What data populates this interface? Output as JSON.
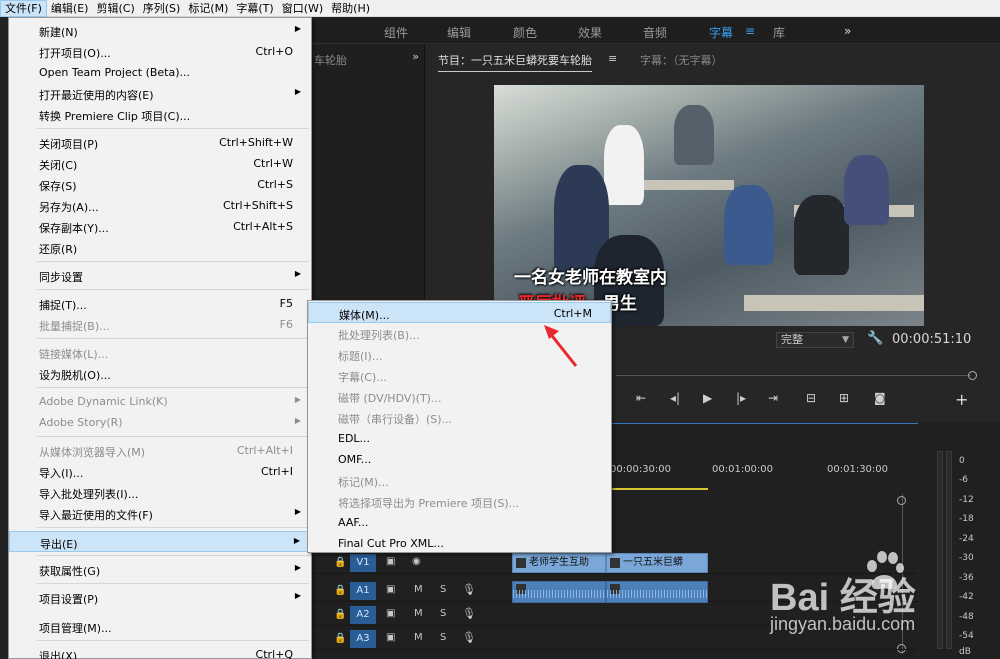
{
  "menubar": {
    "items": [
      "文件(F)",
      "编辑(E)",
      "剪辑(C)",
      "序列(S)",
      "标记(M)",
      "字幕(T)",
      "窗口(W)",
      "帮助(H)"
    ]
  },
  "workspace": {
    "tabs": [
      "组件",
      "编辑",
      "颜色",
      "效果",
      "音频",
      "字幕",
      "库"
    ],
    "active": "字幕"
  },
  "project_panel": {
    "title": "车轮胎"
  },
  "program_monitor": {
    "tab_program": "节目：一只五米巨蟒死要车轮胎",
    "tab_captions": "字幕：（无字幕）",
    "subtitle_line1": "一名女老师在教室内",
    "subtitle_line2_red": "严厉批评",
    "subtitle_line2_white": "一男生",
    "quality": "完整",
    "timecode": "00:00:51:10"
  },
  "timeline": {
    "ruler": [
      "00:00:30:00",
      "00:01:00:00",
      "00:01:30:00"
    ],
    "tracks": [
      "V1",
      "A1",
      "A2",
      "A3"
    ],
    "track_buttons": [
      "M",
      "S"
    ],
    "clips": [
      "老师学生互助",
      "一只五米巨蟒"
    ]
  },
  "audio_meter": {
    "db": [
      "0",
      "-6",
      "-12",
      "-18",
      "-24",
      "-30",
      "-36",
      "-42",
      "-48",
      "-54",
      "dB"
    ]
  },
  "file_menu": {
    "items": [
      {
        "label": "新建(N)",
        "shortcut": "",
        "arrow": true,
        "disabled": false
      },
      {
        "label": "打开项目(O)...",
        "shortcut": "Ctrl+O",
        "arrow": false,
        "disabled": false
      },
      {
        "label": "Open Team Project (Beta)...",
        "shortcut": "",
        "arrow": false,
        "disabled": false
      },
      {
        "label": "打开最近使用的内容(E)",
        "shortcut": "",
        "arrow": true,
        "disabled": false
      },
      {
        "label": "转换 Premiere Clip 项目(C)...",
        "shortcut": "",
        "arrow": false,
        "disabled": false
      },
      {
        "label": "关闭项目(P)",
        "shortcut": "Ctrl+Shift+W",
        "arrow": false,
        "disabled": false
      },
      {
        "label": "关闭(C)",
        "shortcut": "Ctrl+W",
        "arrow": false,
        "disabled": false
      },
      {
        "label": "保存(S)",
        "shortcut": "Ctrl+S",
        "arrow": false,
        "disabled": false
      },
      {
        "label": "另存为(A)...",
        "shortcut": "Ctrl+Shift+S",
        "arrow": false,
        "disabled": false
      },
      {
        "label": "保存副本(Y)...",
        "shortcut": "Ctrl+Alt+S",
        "arrow": false,
        "disabled": false
      },
      {
        "label": "还原(R)",
        "shortcut": "",
        "arrow": false,
        "disabled": false
      },
      {
        "label": "同步设置",
        "shortcut": "",
        "arrow": true,
        "disabled": false
      },
      {
        "label": "捕捉(T)...",
        "shortcut": "F5",
        "arrow": false,
        "disabled": false
      },
      {
        "label": "批量捕捉(B)...",
        "shortcut": "F6",
        "arrow": false,
        "disabled": true
      },
      {
        "label": "链接媒体(L)...",
        "shortcut": "",
        "arrow": false,
        "disabled": true
      },
      {
        "label": "设为脱机(O)...",
        "shortcut": "",
        "arrow": false,
        "disabled": false
      },
      {
        "label": "Adobe Dynamic Link(K)",
        "shortcut": "",
        "arrow": true,
        "disabled": true
      },
      {
        "label": "Adobe Story(R)",
        "shortcut": "",
        "arrow": true,
        "disabled": true
      },
      {
        "label": "从媒体浏览器导入(M)",
        "shortcut": "Ctrl+Alt+I",
        "arrow": false,
        "disabled": true
      },
      {
        "label": "导入(I)...",
        "shortcut": "Ctrl+I",
        "arrow": false,
        "disabled": false
      },
      {
        "label": "导入批处理列表(I)...",
        "shortcut": "",
        "arrow": false,
        "disabled": false
      },
      {
        "label": "导入最近使用的文件(F)",
        "shortcut": "",
        "arrow": true,
        "disabled": false
      },
      {
        "label": "导出(E)",
        "shortcut": "",
        "arrow": true,
        "disabled": false
      },
      {
        "label": "获取属性(G)",
        "shortcut": "",
        "arrow": true,
        "disabled": false
      },
      {
        "label": "项目设置(P)",
        "shortcut": "",
        "arrow": true,
        "disabled": false
      },
      {
        "label": "项目管理(M)...",
        "shortcut": "",
        "arrow": false,
        "disabled": false
      },
      {
        "label": "退出(X)",
        "shortcut": "Ctrl+Q",
        "arrow": false,
        "disabled": false
      }
    ]
  },
  "export_menu": {
    "items": [
      {
        "label": "媒体(M)...",
        "shortcut": "Ctrl+M",
        "disabled": false
      },
      {
        "label": "批处理列表(B)...",
        "shortcut": "",
        "disabled": true
      },
      {
        "label": "标题(I)...",
        "shortcut": "",
        "disabled": true
      },
      {
        "label": "字幕(C)...",
        "shortcut": "",
        "disabled": true
      },
      {
        "label": "磁带 (DV/HDV)(T)...",
        "shortcut": "",
        "disabled": true
      },
      {
        "label": "磁带（串行设备）(S)...",
        "shortcut": "",
        "disabled": true
      },
      {
        "label": "EDL...",
        "shortcut": "",
        "disabled": false
      },
      {
        "label": "OMF...",
        "shortcut": "",
        "disabled": false
      },
      {
        "label": "标记(M)...",
        "shortcut": "",
        "disabled": true
      },
      {
        "label": "将选择项导出为 Premiere 项目(S)...",
        "shortcut": "",
        "disabled": true
      },
      {
        "label": "AAF...",
        "shortcut": "",
        "disabled": false
      },
      {
        "label": "Final Cut Pro XML...",
        "shortcut": "",
        "disabled": false
      }
    ]
  },
  "watermark": {
    "logo_text": "Bai   经验",
    "url": "jingyan.baidu.com"
  },
  "colors": {
    "accent": "#3a9ef0",
    "menu_highlight": "#cce4f7",
    "clip_video": "#7ba7d8",
    "clip_audio": "#4d7fb8",
    "subtitle_red": "#e8282a"
  }
}
